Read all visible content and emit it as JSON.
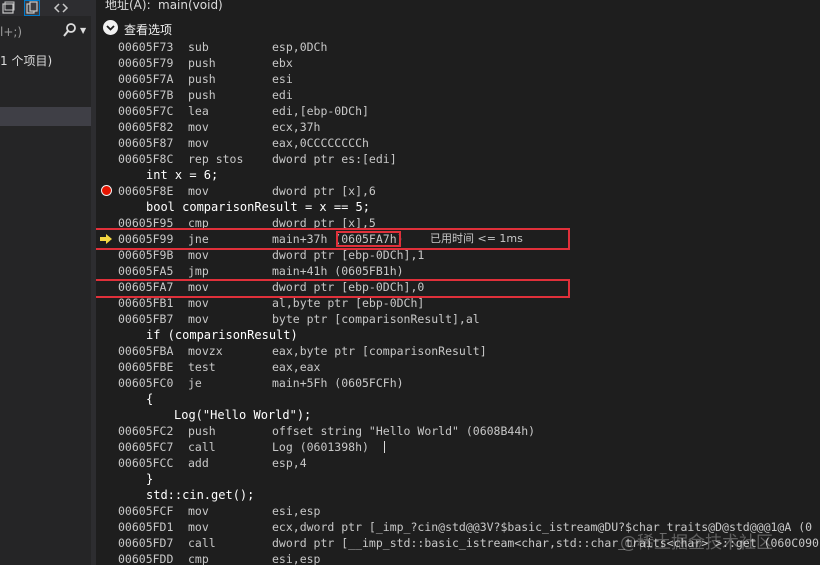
{
  "left_panel": {
    "toolbar_icons": [
      "window-icon",
      "copy-icon",
      "code-brackets-icon"
    ],
    "search_placeholder": "l+;)",
    "item_count": "1 个项目)"
  },
  "address_bar": {
    "label": "地址(A):",
    "value": "main(void)"
  },
  "view_options": {
    "label": "查看选项"
  },
  "lines": [
    {
      "kind": "asm",
      "addr": "00605F73",
      "op": "sub",
      "arg": "esp,0DCh"
    },
    {
      "kind": "asm",
      "addr": "00605F79",
      "op": "push",
      "arg": "ebx"
    },
    {
      "kind": "asm",
      "addr": "00605F7A",
      "op": "push",
      "arg": "esi"
    },
    {
      "kind": "asm",
      "addr": "00605F7B",
      "op": "push",
      "arg": "edi"
    },
    {
      "kind": "asm",
      "addr": "00605F7C",
      "op": "lea",
      "arg": "edi,[ebp-0DCh]"
    },
    {
      "kind": "asm",
      "addr": "00605F82",
      "op": "mov",
      "arg": "ecx,37h"
    },
    {
      "kind": "asm",
      "addr": "00605F87",
      "op": "mov",
      "arg": "eax,0CCCCCCCCh"
    },
    {
      "kind": "asm",
      "addr": "00605F8C",
      "op": "rep stos",
      "arg": "dword ptr es:[edi]"
    },
    {
      "kind": "src",
      "text": "int x = 6;"
    },
    {
      "kind": "asm",
      "addr": "00605F8E",
      "op": "mov",
      "arg": "dword ptr [x],6",
      "marker": "breakpoint"
    },
    {
      "kind": "src",
      "text": "bool comparisonResult = x == 5;"
    },
    {
      "kind": "asm",
      "addr": "00605F95",
      "op": "cmp",
      "arg": "dword ptr [x],5"
    },
    {
      "kind": "asm",
      "addr": "00605F99",
      "op": "jne",
      "arg": "main+37h (0605FA7h)",
      "marker": "current",
      "elapsed": "已用时间 <= 1ms"
    },
    {
      "kind": "asm",
      "addr": "00605F9B",
      "op": "mov",
      "arg": "dword ptr [ebp-0DCh],1"
    },
    {
      "kind": "asm",
      "addr": "00605FA5",
      "op": "jmp",
      "arg": "main+41h (0605FB1h)"
    },
    {
      "kind": "asm",
      "addr": "00605FA7",
      "op": "mov",
      "arg": "dword ptr [ebp-0DCh],0"
    },
    {
      "kind": "asm",
      "addr": "00605FB1",
      "op": "mov",
      "arg": "al,byte ptr [ebp-0DCh]"
    },
    {
      "kind": "asm",
      "addr": "00605FB7",
      "op": "mov",
      "arg": "byte ptr [comparisonResult],al"
    },
    {
      "kind": "src",
      "text": "if (comparisonResult)"
    },
    {
      "kind": "asm",
      "addr": "00605FBA",
      "op": "movzx",
      "arg": "eax,byte ptr [comparisonResult]"
    },
    {
      "kind": "asm",
      "addr": "00605FBE",
      "op": "test",
      "arg": "eax,eax"
    },
    {
      "kind": "asm",
      "addr": "00605FC0",
      "op": "je",
      "arg": "main+5Fh (0605FCFh)"
    },
    {
      "kind": "src",
      "text": "{"
    },
    {
      "kind": "src2",
      "text": "Log(\"Hello World\");"
    },
    {
      "kind": "asm",
      "addr": "00605FC2",
      "op": "push",
      "arg": "offset string \"Hello World\" (0608B44h)"
    },
    {
      "kind": "asm",
      "addr": "00605FC7",
      "op": "call",
      "arg": "Log (0601398h)",
      "cursor": true
    },
    {
      "kind": "asm",
      "addr": "00605FCC",
      "op": "add",
      "arg": "esp,4"
    },
    {
      "kind": "src",
      "text": "}"
    },
    {
      "kind": "src",
      "text": "std::cin.get();"
    },
    {
      "kind": "asm",
      "addr": "00605FCF",
      "op": "mov",
      "arg": "esi,esp"
    },
    {
      "kind": "asm",
      "addr": "00605FD1",
      "op": "mov",
      "arg": "ecx,dword ptr [_imp_?cin@std@@3V?$basic_istream@DU?$char_traits@D@std@@@1@A (0"
    },
    {
      "kind": "asm",
      "addr": "00605FD7",
      "op": "call",
      "arg": "dword ptr [__imp_std::basic_istream<char,std::char_traits<char> >::get (060C090"
    },
    {
      "kind": "asm",
      "addr": "00605FDD",
      "op": "cmp",
      "arg": "esi,esp"
    }
  ],
  "watermark": "@稀土掘金技术社区",
  "colors": {
    "highlight_box": "#e0303a",
    "breakpoint": "#e51400",
    "current_arrow": "#f5d742"
  }
}
